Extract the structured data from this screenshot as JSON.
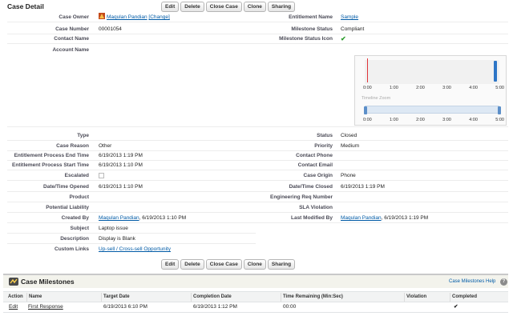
{
  "detail_title": "Case Detail",
  "buttons": [
    "Edit",
    "Delete",
    "Close Case",
    "Clone",
    "Sharing"
  ],
  "case_owner": {
    "label": "Case Owner",
    "name": "Maqulan Pandian",
    "change": "[Change]"
  },
  "case_number": {
    "label": "Case Number",
    "value": "00001054"
  },
  "contact_name": {
    "label": "Contact Name",
    "value": ""
  },
  "account_name": {
    "label": "Account Name",
    "value": ""
  },
  "entitlement_name": {
    "label": "Entitlement Name",
    "value": "Sample"
  },
  "milestone_status": {
    "label": "Milestone Status",
    "value": "Compliant"
  },
  "milestone_status_icon": {
    "label": "Milestone Status Icon",
    "icon": "green-check-icon",
    "glyph": "✔"
  },
  "timeline": {
    "ticks": [
      "0:00",
      "1:00",
      "2:00",
      "3:00",
      "4:00",
      "5:00"
    ],
    "zoom_label": "Timeline Zoom",
    "zoom_ticks": [
      "0:00",
      "1:00",
      "2:00",
      "3:00",
      "4:00",
      "5:00"
    ]
  },
  "left_fields": [
    {
      "label": "Type",
      "value": ""
    },
    {
      "label": "Case Reason",
      "value": "Other"
    },
    {
      "label": "Entitlement Process End Time",
      "value": "6/19/2013 1:19 PM"
    },
    {
      "label": "Entitlement Process Start Time",
      "value": "6/19/2013 1:10 PM"
    },
    {
      "label": "Escalated",
      "value": ""
    },
    {
      "label": "Date/Time Opened",
      "value": "6/19/2013 1:10 PM"
    },
    {
      "label": "Product",
      "value": ""
    },
    {
      "label": "Potential Liability",
      "value": ""
    }
  ],
  "right_fields": [
    {
      "label": "Status",
      "value": "Closed"
    },
    {
      "label": "Priority",
      "value": "Medium"
    },
    {
      "label": "Contact Phone",
      "value": ""
    },
    {
      "label": "Contact Email",
      "value": ""
    },
    {
      "label": "Case Origin",
      "value": "Phone"
    },
    {
      "label": "Date/Time Closed",
      "value": "6/19/2013 1:19 PM"
    },
    {
      "label": "Engineering Req Number",
      "value": ""
    },
    {
      "label": "SLA Violation",
      "value": ""
    }
  ],
  "created_by": {
    "label": "Created By",
    "name": "Maqulan Pandian",
    "date": ", 6/19/2013 1:10 PM"
  },
  "last_modified_by": {
    "label": "Last Modified By",
    "name": "Maqulan Pandian",
    "date": ", 6/19/2013 1:19 PM"
  },
  "subject": {
    "label": "Subject",
    "value": "Laptop issue"
  },
  "description": {
    "label": "Description",
    "value": "Display is Blank"
  },
  "custom_links": {
    "label": "Custom Links",
    "value": "Up-sell / Cross-sell Opportunity"
  },
  "milestones": {
    "title": "Case Milestones",
    "help": "Case Milestones Help",
    "help_glyph": "?",
    "columns": [
      "Action",
      "Name",
      "Target Date",
      "Completion Date",
      "Time Remaining (Min:Sec)",
      "Violation",
      "Completed"
    ],
    "row": {
      "action": "Edit",
      "name": "First Response",
      "target": "6/19/2013 6:10 PM",
      "completion": "6/19/2013 1:12 PM",
      "remaining": "00:00",
      "violation": "",
      "completed_glyph": "✔"
    }
  }
}
